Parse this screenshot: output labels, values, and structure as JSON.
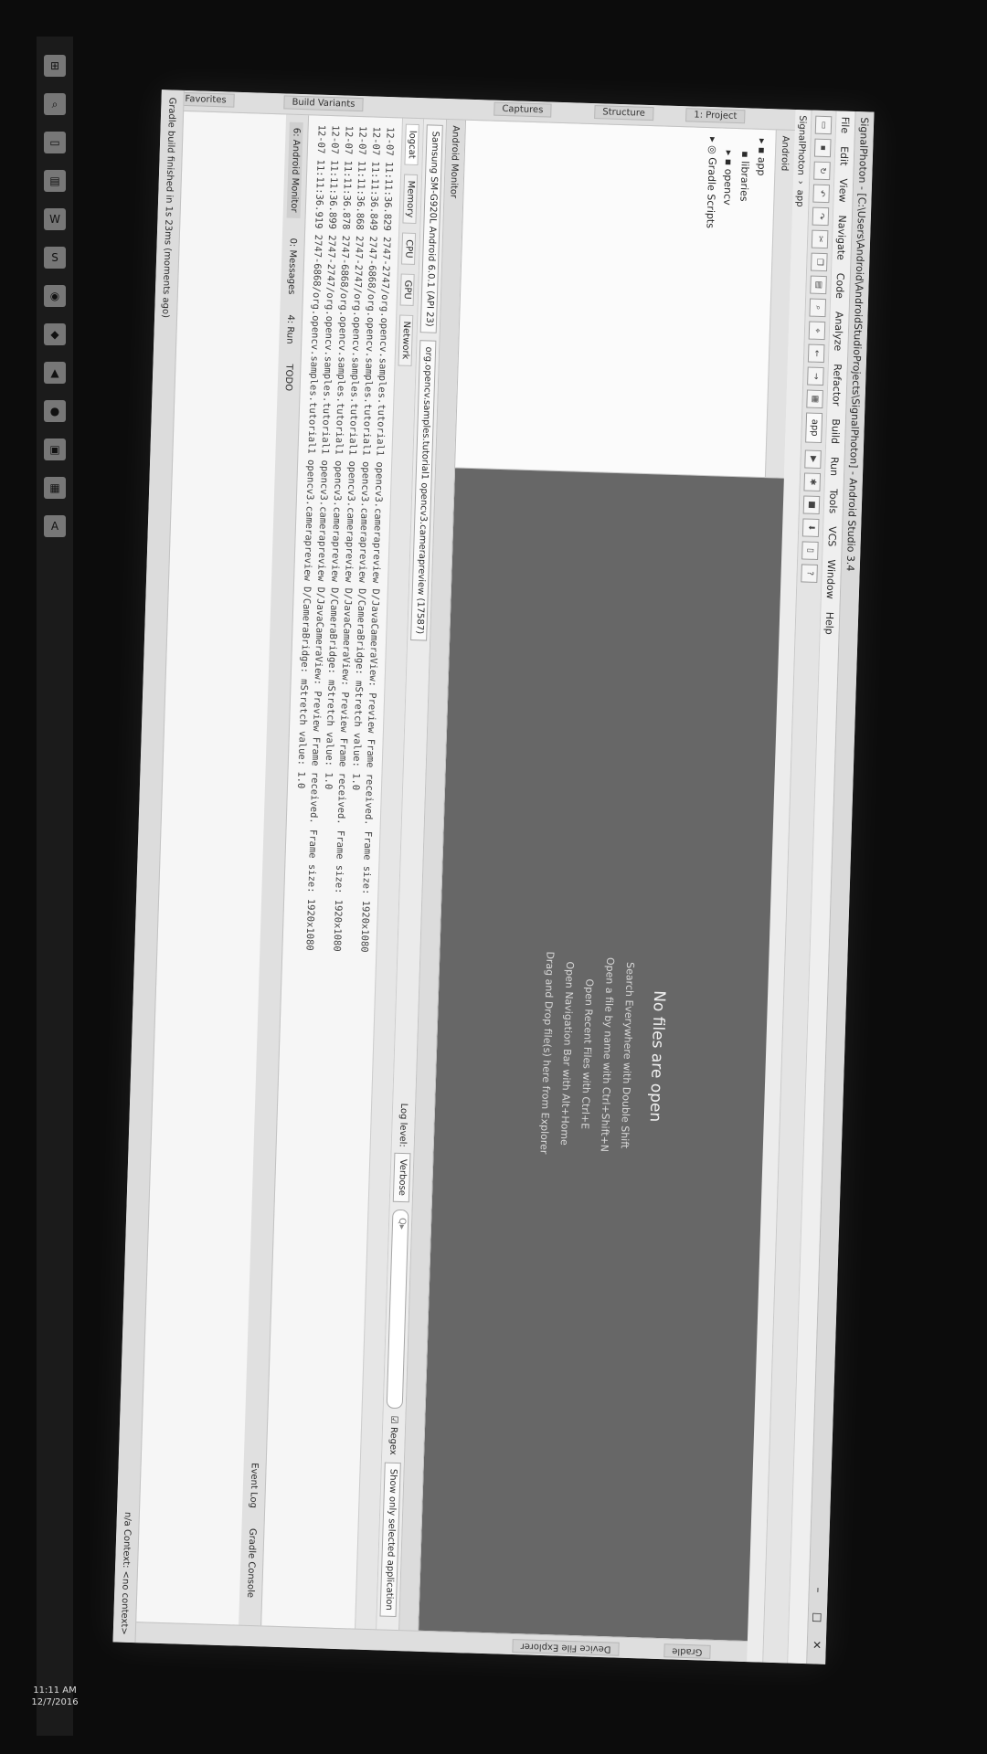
{
  "window": {
    "title": "SignalPhoton - [C:\\Users\\Android\\AndroidStudioProjects\\SignalPhoton] - Android Studio 3.4",
    "minimize": "–",
    "maximize": "□",
    "close": "✕"
  },
  "menu": [
    "File",
    "Edit",
    "View",
    "Navigate",
    "Code",
    "Analyze",
    "Refactor",
    "Build",
    "Run",
    "Tools",
    "VCS",
    "Window",
    "Help"
  ],
  "toolbar": {
    "run_config": "app",
    "device": "SignalPhoton",
    "help": "?"
  },
  "nav": {
    "project": "SignalPhoton",
    "module": "app"
  },
  "side_tabs": {
    "project": "1: Project",
    "structure": "Structure",
    "captures": "Captures",
    "build_variants": "Build Variants",
    "favorites": "2: Favorites"
  },
  "right_tabs": {
    "gradle": "Gradle",
    "device_file_explorer": "Device File Explorer"
  },
  "project_panel": {
    "header": "Android",
    "tree": [
      "app",
      "libraries",
      "opencv",
      "Gradle Scripts"
    ]
  },
  "editor": {
    "empty_title": "No files are open",
    "tips": [
      "Search Everywhere with Double Shift",
      "Open a file by name with Ctrl+Shift+N",
      "Open Recent Files with Ctrl+E",
      "Open Navigation Bar with Alt+Home",
      "Drag and Drop file(s) here from Explorer"
    ]
  },
  "logcat": {
    "header": "Android Monitor",
    "device": "Samsung SM-G920L Android 6.0.1 (API 23)",
    "process": "org.opencv.samples.tutorial1 opencv3.camerapreview (17587)",
    "log_level": "Log level:",
    "level_value": "Verbose",
    "search_placeholder": "Q▸",
    "regex": "Regex",
    "filter": "Show only selected application",
    "tabs": [
      "logcat",
      "Memory",
      "CPU",
      "GPU",
      "Network"
    ],
    "lines": [
      "12-07 11:11:36.829 2747-2747/org.opencv.samples.tutorial1 opencv3.camerapreview D/JavaCameraView: Preview Frame received. Frame size: 1920x1080",
      "12-07 11:11:36.849 2747-6868/org.opencv.samples.tutorial1 opencv3.camerapreview D/CameraBridge: mStretch value: 1.0",
      "12-07 11:11:36.868 2747-2747/org.opencv.samples.tutorial1 opencv3.camerapreview D/JavaCameraView: Preview Frame received. Frame size: 1920x1080",
      "12-07 11:11:36.878 2747-6868/org.opencv.samples.tutorial1 opencv3.camerapreview D/CameraBridge: mStretch value: 1.0",
      "12-07 11:11:36.899 2747-2747/org.opencv.samples.tutorial1 opencv3.camerapreview D/JavaCameraView: Preview Frame received. Frame size: 1920x1080",
      "12-07 11:11:36.919 2747-6868/org.opencv.samples.tutorial1 opencv3.camerapreview D/CameraBridge: mStretch value: 1.0"
    ]
  },
  "bottom_tabs": [
    "6: Android Monitor",
    "0: Messages",
    "4: Run",
    "TODO",
    "Event Log",
    "Gradle Console"
  ],
  "status": {
    "message": "Gradle build finished in 1s 23ms (moments ago)",
    "right": "n/a   Context: <no context>"
  },
  "taskbar": {
    "time": "11:11 AM",
    "date": "12/7/2016"
  }
}
